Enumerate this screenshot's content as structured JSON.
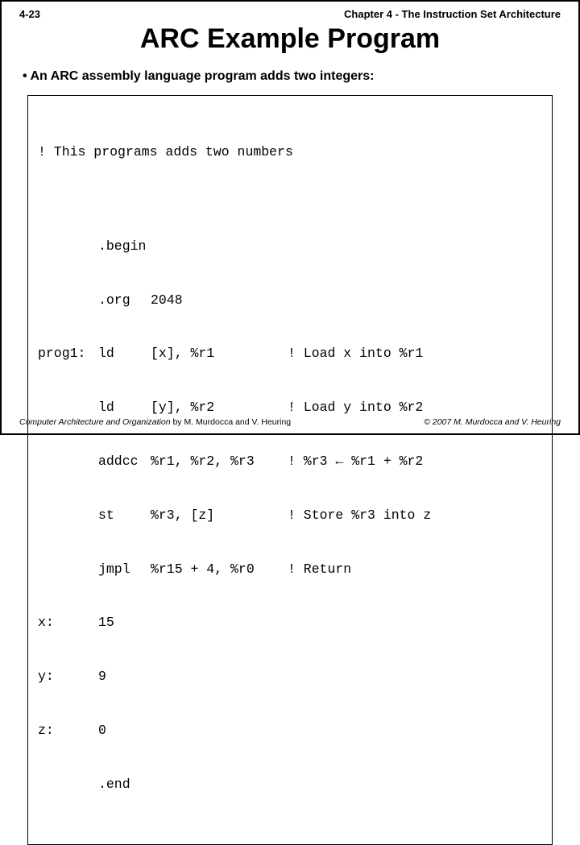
{
  "header": {
    "page_num": "4-23",
    "chapter": "Chapter 4 - The Instruction Set Architecture"
  },
  "title": "ARC Example Program",
  "bullet": "• An ARC assembly language program adds two integers:",
  "code": {
    "comment_top": "! This programs adds two numbers",
    "rows": [
      {
        "label": "",
        "op": ".begin",
        "args": "",
        "cmt": ""
      },
      {
        "label": "",
        "op": ".org",
        "args": "2048",
        "cmt": ""
      },
      {
        "label": "prog1:",
        "op": "ld",
        "args": "[x], %r1",
        "cmt": "! Load x into %r1"
      },
      {
        "label": "",
        "op": "ld",
        "args": "[y], %r2",
        "cmt": "! Load y into %r2"
      },
      {
        "label": "",
        "op": "addcc",
        "args": "%r1, %r2, %r3",
        "cmt": "! %r3 ← %r1 + %r2"
      },
      {
        "label": "",
        "op": "st",
        "args": "%r3, [z]",
        "cmt": "! Store %r3 into z"
      },
      {
        "label": "",
        "op": "jmpl",
        "args": "%r15 + 4, %r0",
        "cmt": "! Return"
      },
      {
        "label": "x:",
        "op": "15",
        "args": "",
        "cmt": ""
      },
      {
        "label": "y:",
        "op": "9",
        "args": "",
        "cmt": ""
      },
      {
        "label": "z:",
        "op": "0",
        "args": "",
        "cmt": ""
      },
      {
        "label": "",
        "op": ".end",
        "args": "",
        "cmt": ""
      }
    ]
  },
  "footer": {
    "book": "Computer Architecture and Organization",
    "by": " by M. Murdocca and V. Heuring",
    "copyright": "© 2007 M. Murdocca and V. Heuring"
  }
}
